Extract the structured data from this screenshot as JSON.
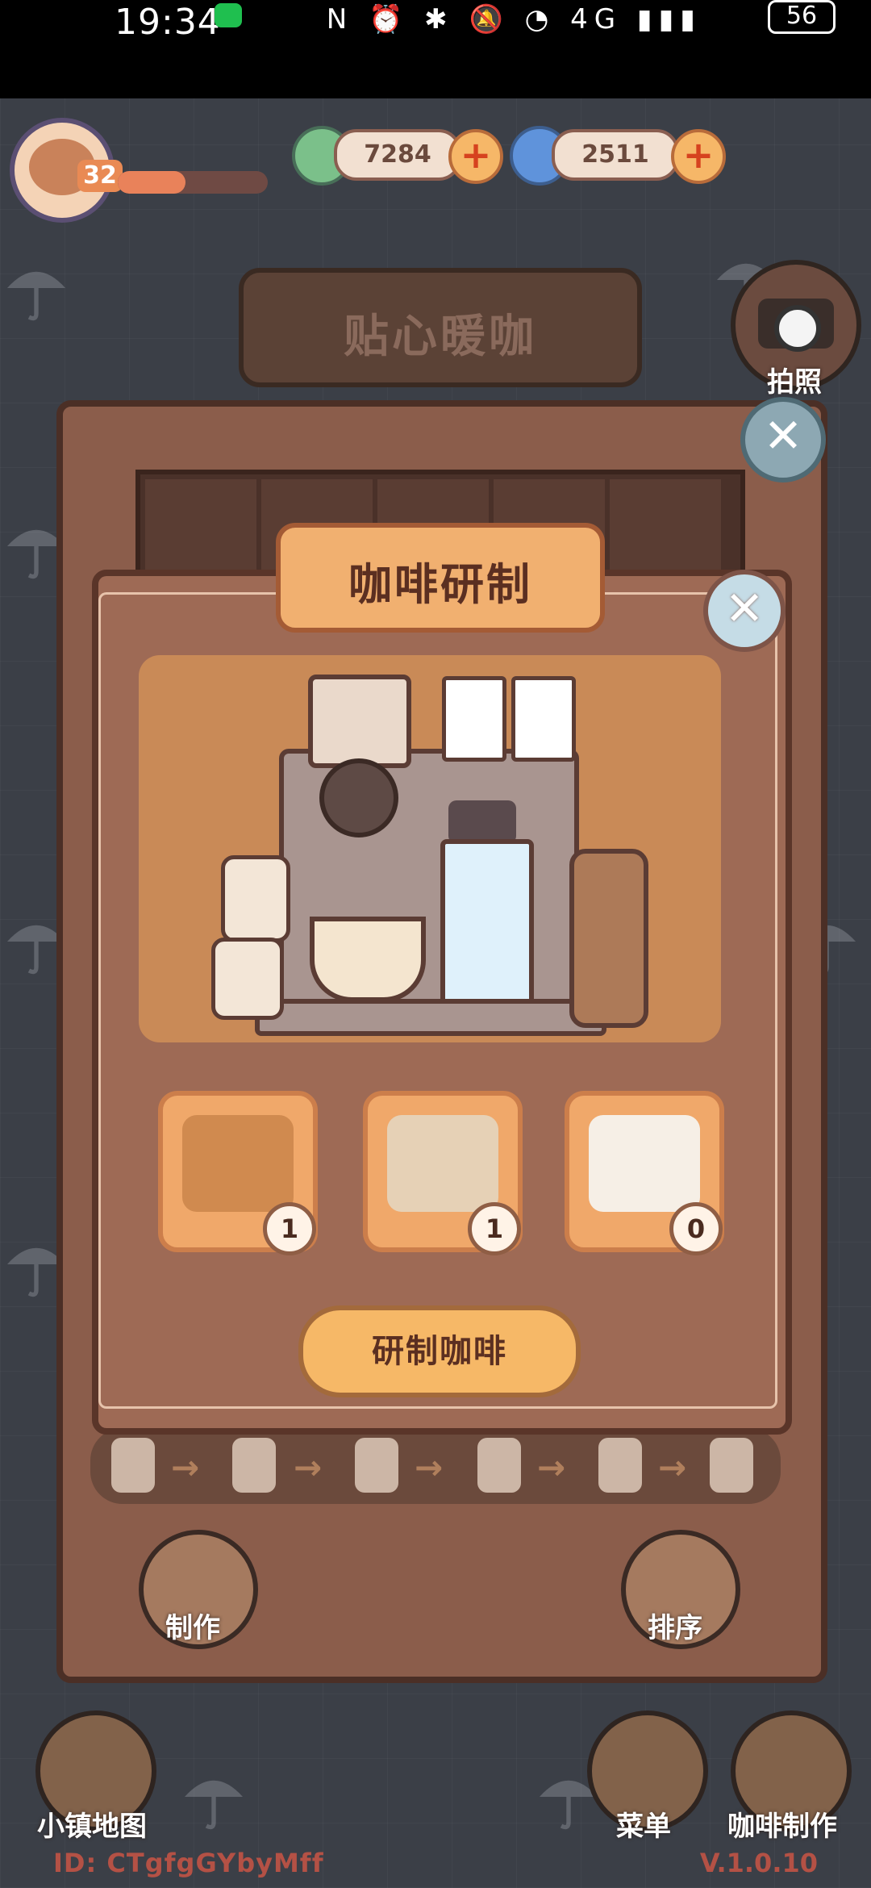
{
  "status_bar": {
    "time": "19:34",
    "icons_text": "N ⏰ ✱ 🔕 ◔ 4G ▮▮▮",
    "battery": "56"
  },
  "hud": {
    "level": "32",
    "xp_progress": 0.45,
    "currency_green": "7284",
    "currency_blue": "2511",
    "title_sign": "贴心暖咖",
    "camera_label": "拍照"
  },
  "modal": {
    "title": "咖啡研制",
    "close_symbol": "✕",
    "ingredients": [
      {
        "name": "coffee-beans",
        "count": "1"
      },
      {
        "name": "milk-powder",
        "count": "1"
      },
      {
        "name": "milk-pitcher",
        "count": "0"
      }
    ],
    "brew_button": "研制咖啡"
  },
  "back_panel": {
    "close_symbol": "✕",
    "make_label": "制作",
    "sort_label": "排序"
  },
  "bottom_nav": {
    "map_label": "小镇地图",
    "menu_label": "菜单",
    "coffee_label": "咖啡制作"
  },
  "footer": {
    "id_text": "ID: CTgfgGYbyMff",
    "version": "V.1.0.10"
  },
  "colors": {
    "panel": "#8b5d4b",
    "modal": "#9e6a55",
    "button": "#f6b867",
    "accent_text": "#5b2f21"
  }
}
